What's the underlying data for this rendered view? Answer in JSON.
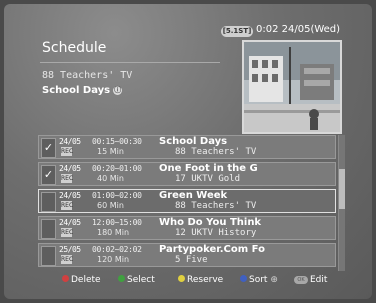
{
  "header": {
    "badge": "[5.1ST]",
    "clock": "0:02 24/05(Wed)",
    "title": "Schedule",
    "channel": "88 Teachers' TV",
    "program": "School Days",
    "info_icon": "ⓘ"
  },
  "rows": [
    {
      "mark": "✓",
      "date": "24/05",
      "icon": "REC",
      "time": "00:15~00:30",
      "duration": "15 Min",
      "program": "School Days",
      "channel": "88 Teachers' TV"
    },
    {
      "mark": "✓",
      "date": "24/05",
      "icon": "REC",
      "time": "00:20~01:00",
      "duration": "40 Min",
      "program": "One Foot in the G",
      "channel": "17 UKTV Gold"
    },
    {
      "mark": "",
      "date": "24/05",
      "icon": "REC",
      "time": "01:00~02:00",
      "duration": "60 Min",
      "program": "Green Week",
      "channel": "88 Teachers' TV"
    },
    {
      "mark": "",
      "date": "24/05",
      "icon": "REC",
      "time": "12:00~15:00",
      "duration": "180 Min",
      "program": "Who Do You Think",
      "channel": "12 UKTV History"
    },
    {
      "mark": "",
      "date": "25/05",
      "icon": "REC",
      "time": "00:02~02:02",
      "duration": "120 Min",
      "program": "Partypoker.Com Fo",
      "channel": "5 Five"
    }
  ],
  "footer": {
    "delete": "Delete",
    "select": "Select",
    "reserve": "Reserve",
    "sort": "Sort",
    "edit_btn": "OK",
    "edit": "Edit"
  },
  "colors": {
    "delete_dot": "#d04040",
    "select_dot": "#40a040",
    "reserve_dot": "#e0d040",
    "sort_dot": "#4060c0"
  }
}
